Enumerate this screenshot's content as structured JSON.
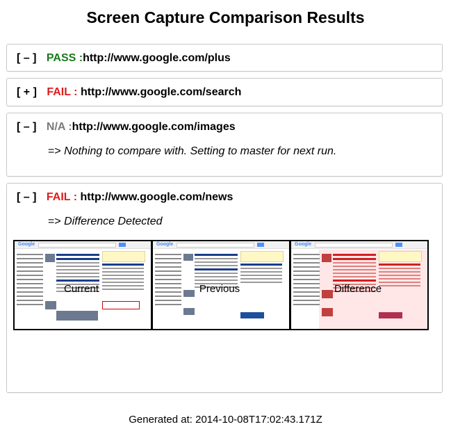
{
  "title": "Screen Capture Comparison Results",
  "results": [
    {
      "toggle": "[ – ]",
      "status": "PASS :",
      "url": "http://www.google.com/plus",
      "status_color": "#1a7a1a"
    },
    {
      "toggle": "[ + ]",
      "status": "FAIL :",
      "url": "http://www.google.com/search",
      "status_color": "#e01b1b"
    },
    {
      "toggle": "[ – ]",
      "status": "N/A :",
      "url": "http://www.google.com/images",
      "status_color": "#7a7a7a",
      "prefix": "=>",
      "message": "Nothing to compare with. Setting to master for next run."
    },
    {
      "toggle": "[ – ]",
      "status": "FAIL :",
      "url": "http://www.google.com/news",
      "status_color": "#e01b1b",
      "prefix": "=>",
      "message": "Difference Detected",
      "captions": [
        "Current",
        "Previous",
        "Difference"
      ]
    }
  ],
  "footer": "Generated at: 2014-10-08T17:02:43.171Z"
}
